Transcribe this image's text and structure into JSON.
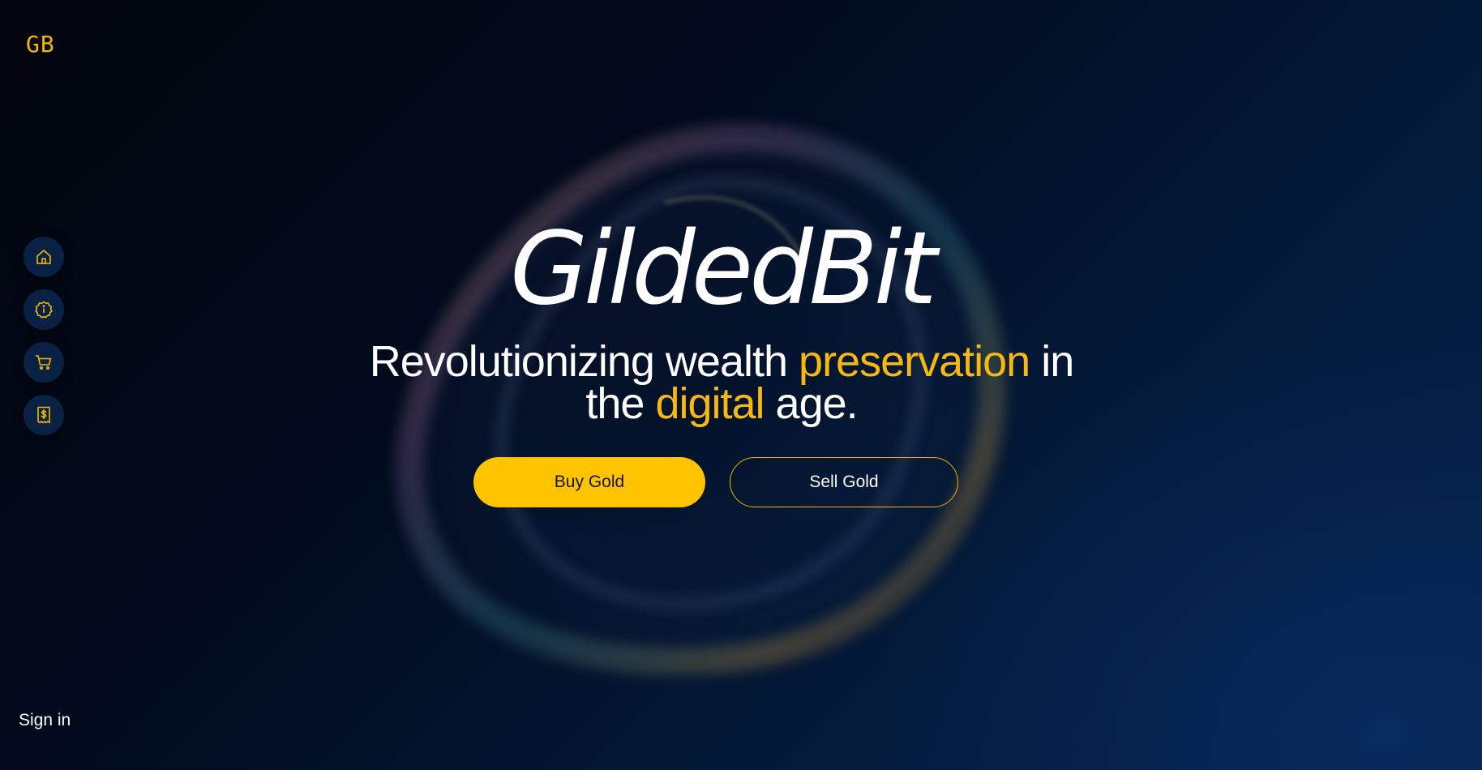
{
  "brand": {
    "logo_text": "GB",
    "name": "GildedBit"
  },
  "sidebar": {
    "items": [
      {
        "icon": "home-icon",
        "label": "Home"
      },
      {
        "icon": "info-icon",
        "label": "About"
      },
      {
        "icon": "cart-icon",
        "label": "Shop"
      },
      {
        "icon": "receipt-dollar-icon",
        "label": "Sell"
      }
    ]
  },
  "hero": {
    "title": "GildedBit",
    "tagline": {
      "part1": "Revolutionizing wealth ",
      "accent1": "preservation",
      "part2": " in the ",
      "accent2": "digital",
      "part3": " age."
    }
  },
  "actions": {
    "buy_label": "Buy Gold",
    "sell_label": "Sell Gold"
  },
  "footer": {
    "signin_label": "Sign in"
  },
  "colors": {
    "accent": "#ffc300",
    "accent_text": "#f7b90f",
    "background_dark": "#03060e",
    "background_blue": "#04214a",
    "nav_button": "#0a2146"
  }
}
